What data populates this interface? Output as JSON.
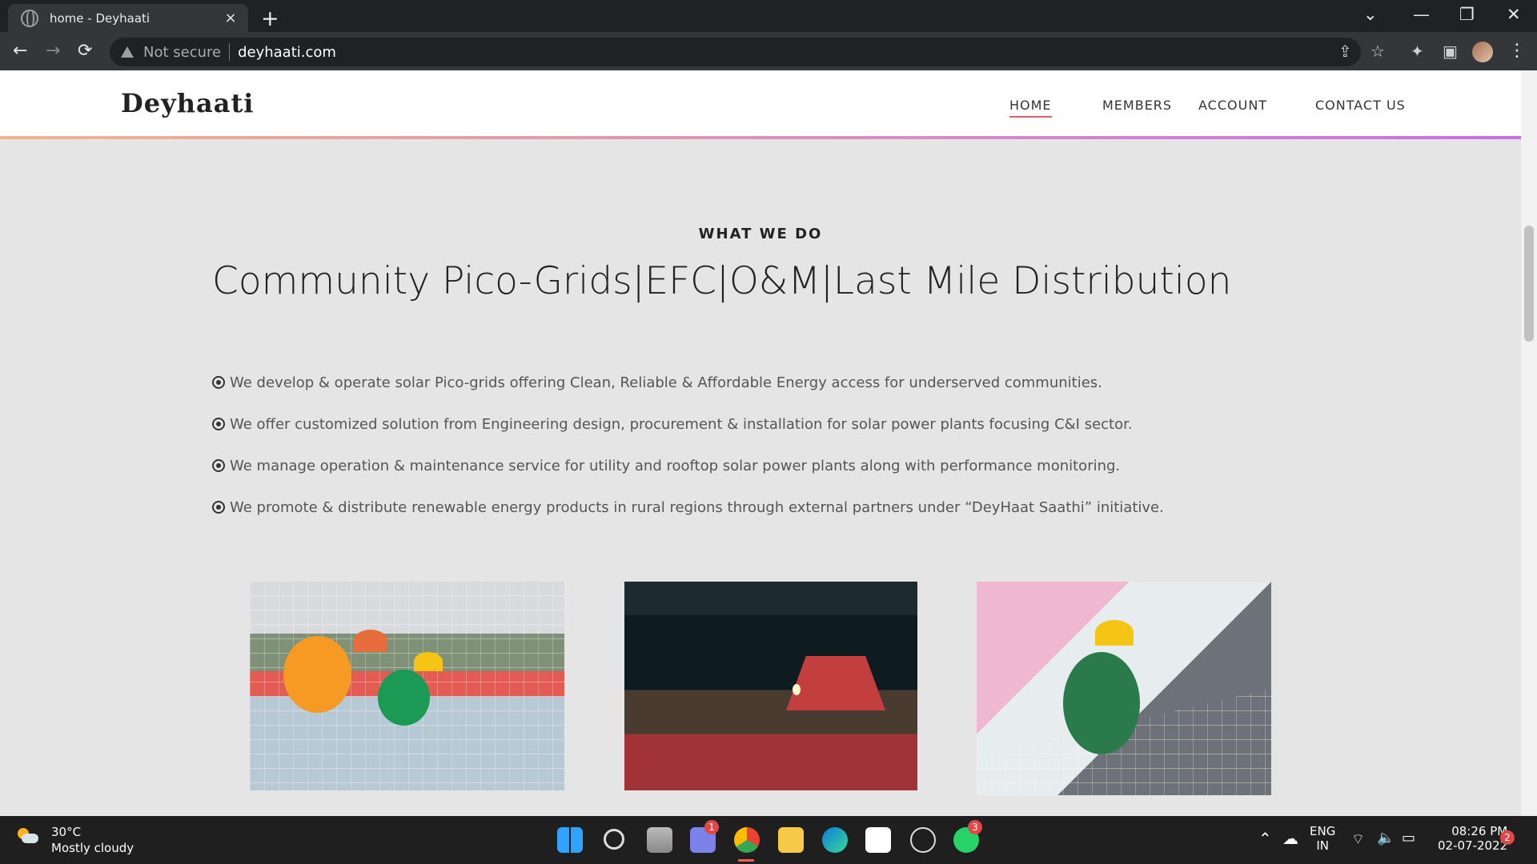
{
  "browser": {
    "tab_title": "home - Deyhaati",
    "new_tab_icon": "+",
    "not_secure": "Not secure",
    "url": "deyhaati.com",
    "tab_close": "×"
  },
  "site": {
    "logo": "Deyhaati",
    "nav": [
      "HOME",
      "MEMBERS",
      "ACCOUNT",
      "CONTACT US"
    ]
  },
  "content": {
    "kicker": "WHAT WE DO",
    "headline": "Community Pico-Grids|EFC|O&M|Last Mile Distribution",
    "bullets": [
      "We develop & operate solar Pico-grids offering Clean, Reliable & Affordable Energy access for underserved communities.",
      "We offer customized solution from Engineering design, procurement & installation for solar power plants focusing C&I sector.",
      "We manage operation & maintenance service for utility and rooftop solar power plants along with performance monitoring.",
      "We promote & distribute renewable energy products in rural regions through external partners under “DeyHaat Saathi” initiative."
    ]
  },
  "taskbar": {
    "temperature": "30°C",
    "weather": "Mostly cloudy",
    "teams_badge": "1",
    "whatsapp_badge": "3",
    "lang1": "ENG",
    "lang2": "IN",
    "time": "08:26 PM",
    "date": "02-07-2022",
    "notification_badge": "2"
  },
  "icons": {
    "back": "←",
    "forward": "→",
    "reload": "⟳",
    "share": "⇪",
    "star": "☆",
    "extensions": "✦",
    "sidebar": "▣",
    "menu": "⋮",
    "chevron": "⌄",
    "minimize": "—",
    "restore": "❐",
    "close": "✕"
  }
}
